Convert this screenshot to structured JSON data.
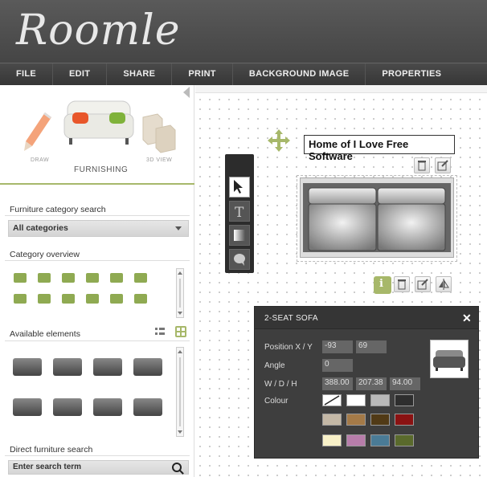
{
  "app": {
    "logo": "Roomle"
  },
  "menu": [
    "FILE",
    "EDIT",
    "SHARE",
    "PRINT",
    "BACKGROUND IMAGE",
    "PROPERTIES"
  ],
  "modes": {
    "draw": "DRAW",
    "furnishing": "FURNISHING",
    "view3d": "3D VIEW"
  },
  "sidebar": {
    "category_search_title": "Furniture category search",
    "category_selected": "All categories",
    "overview_title": "Category overview",
    "available_title": "Available elements",
    "direct_search_title": "Direct furniture search",
    "search_placeholder": "Enter search term"
  },
  "canvas": {
    "plan_title": "Home of I Love Free Software"
  },
  "properties": {
    "title": "2-SEAT SOFA",
    "position_label": "Position X / Y",
    "position_x": "-93",
    "position_y": "69",
    "angle_label": "Angle",
    "angle": "0",
    "dims_label": "W / D / H",
    "width": "388.00",
    "depth": "207.38",
    "height": "94.00",
    "colour_label": "Colour",
    "colours": [
      "none",
      "#ffffff",
      "#b9b9b9",
      "#2e2e2e",
      "#c4b8a6",
      "#a47a48",
      "#513a16",
      "#8a1212",
      "#f8f1c8",
      "#b77daa",
      "#4a7b96",
      "#5a6a2c"
    ]
  },
  "colors": {
    "accent": "#a7b86a",
    "header": "#4d4d4d"
  }
}
